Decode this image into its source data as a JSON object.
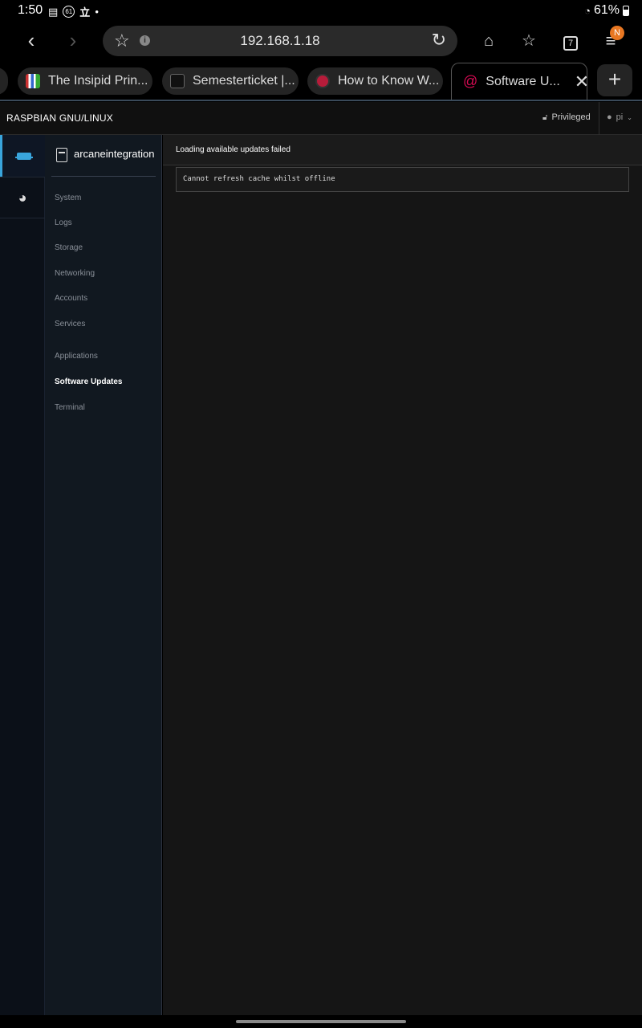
{
  "status_bar": {
    "time": "1:50",
    "notif_badge": "61",
    "battery": "61%"
  },
  "browser": {
    "url": "192.168.1.18",
    "tab_count": "7",
    "menu_badge": "N",
    "tabs": [
      {
        "label": "The Insipid Prin...",
        "active": false
      },
      {
        "label": "Semesterticket |...",
        "active": false
      },
      {
        "label": "How to Know W...",
        "active": false
      },
      {
        "label": "Software U...",
        "active": true
      }
    ]
  },
  "cockpit": {
    "brand": "RASPBIAN GNU/LINUX",
    "privileged": "Privileged",
    "user": "pi",
    "host": "arcaneintegration",
    "nav": [
      {
        "label": "System",
        "active": false
      },
      {
        "label": "Logs",
        "active": false
      },
      {
        "label": "Storage",
        "active": false
      },
      {
        "label": "Networking",
        "active": false
      },
      {
        "label": "Accounts",
        "active": false
      },
      {
        "label": "Services",
        "active": false
      },
      {
        "label": "Applications",
        "active": false
      },
      {
        "label": "Software Updates",
        "active": true
      },
      {
        "label": "Terminal",
        "active": false
      }
    ],
    "alert": "Loading available updates failed",
    "error_detail": "Cannot refresh cache whilst offline"
  },
  "colors": {
    "accent": "#39a5dc",
    "background": "#151515",
    "nav_background": "#111820"
  }
}
